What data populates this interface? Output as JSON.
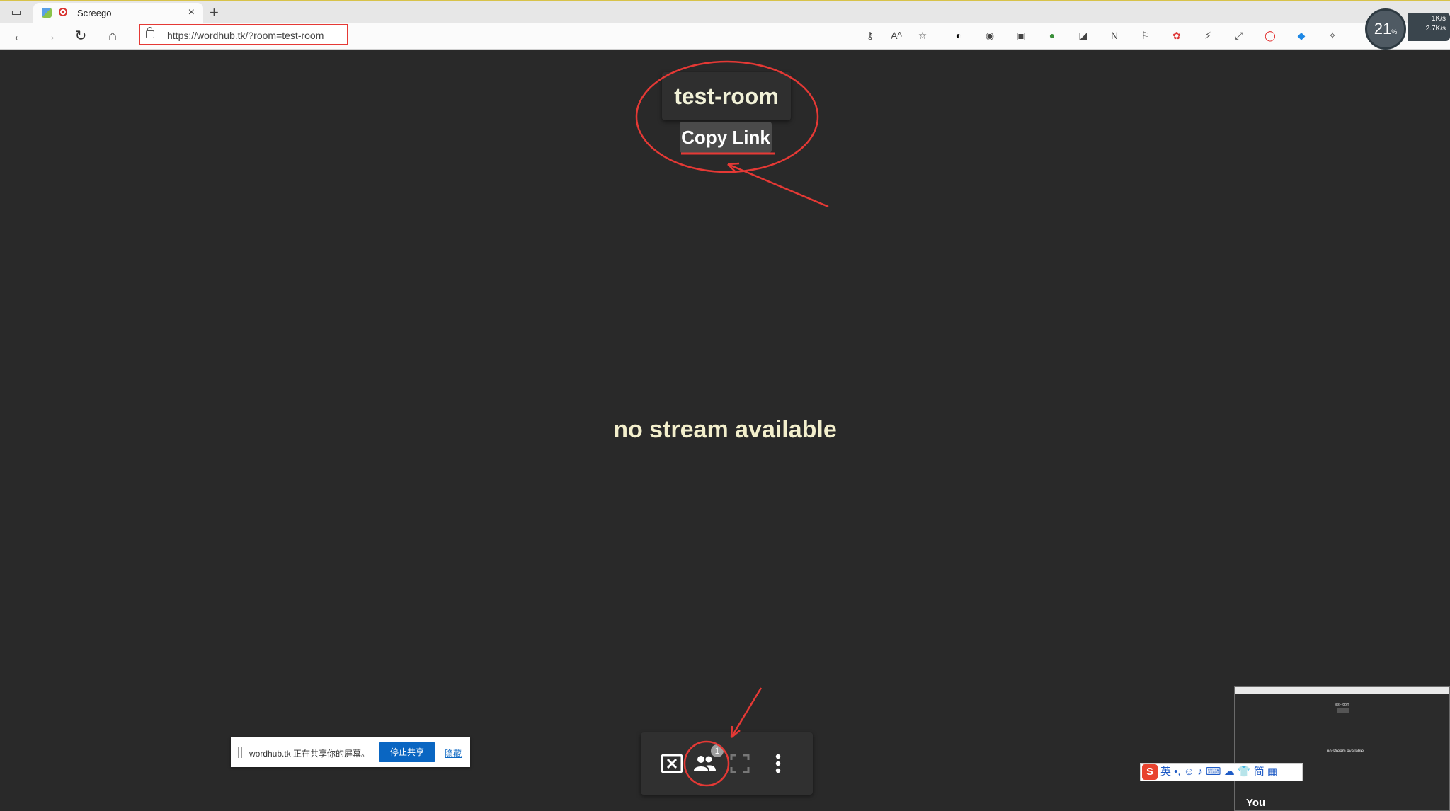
{
  "browser": {
    "tab_title": "Screego",
    "tab_close": "×",
    "new_tab": "+",
    "url": "https://wordhub.tk/?room=test-room",
    "nav": {
      "back": "←",
      "forward": "→",
      "reload": "↻",
      "home": "⌂"
    },
    "extensions": [
      "key-icon",
      "read-aloud-icon",
      "favorite-icon",
      "ext-1",
      "ext-2",
      "ext-3",
      "ext-4",
      "ext-5",
      "ext-6",
      "bookmark-icon",
      "ext-7",
      "ext-8",
      "ext-9",
      "opera-icon",
      "ext-10",
      "extensions-icon"
    ],
    "cpu_widget": {
      "value": "21",
      "unit": "%"
    },
    "net_speed": {
      "up": "1K/s",
      "down": "2.7K/s"
    }
  },
  "app": {
    "room_name": "test-room",
    "copy_link": "Copy Link",
    "no_stream": "no stream available",
    "controls": {
      "stop_share_icon": "close-box-icon",
      "users_icon": "people-icon",
      "users_badge": "1",
      "fullscreen_icon": "fullscreen-icon",
      "more_icon": "more-vert-icon"
    }
  },
  "share_bar": {
    "message": "wordhub.tk 正在共享你的屏幕。",
    "stop_button": "停止共享",
    "hide_link": "隐藏"
  },
  "preview": {
    "label": "You",
    "room_name": "test-room",
    "no_stream": "no stream available"
  },
  "ime_toolbar": {
    "logo": "S",
    "items": "英 •, ☺ ♪ ⌨ ☁ 👕 简 ▦"
  },
  "colors": {
    "background": "#292929",
    "annotation": "#e53935",
    "accent_blue": "#0a66c2",
    "text_light": "#f3efcc"
  }
}
